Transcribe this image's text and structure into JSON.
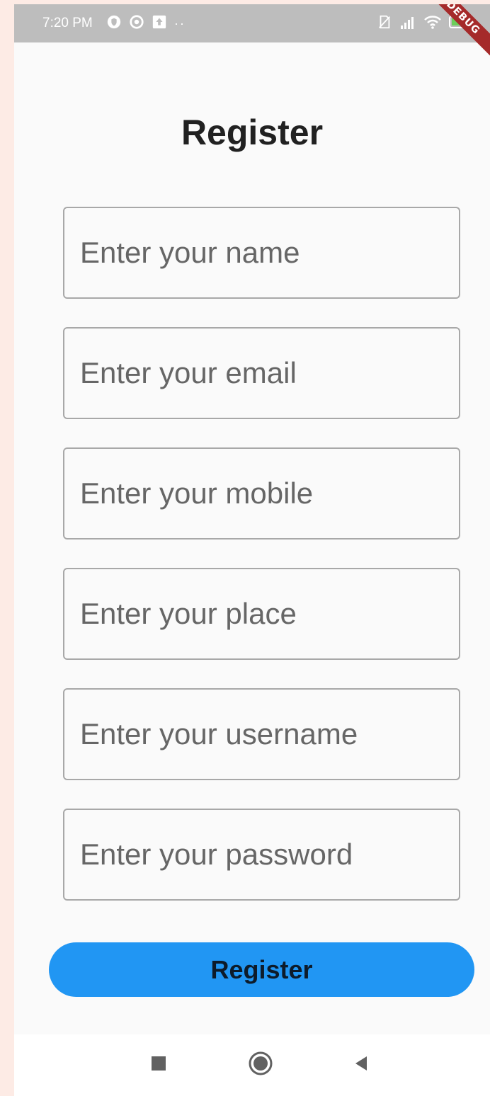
{
  "status_bar": {
    "time": "7:20 PM",
    "dots": "··",
    "debug_label": "DEBUG"
  },
  "page": {
    "title": "Register"
  },
  "form": {
    "name_placeholder": "Enter your name",
    "email_placeholder": "Enter your email",
    "mobile_placeholder": "Enter your mobile",
    "place_placeholder": "Enter your place",
    "username_placeholder": "Enter your username",
    "password_placeholder": "Enter your password",
    "submit_label": "Register"
  },
  "colors": {
    "primary": "#2196f3",
    "status_bar": "#bdbdbd",
    "debug_ribbon": "#a52a2a",
    "background": "#fafafa"
  },
  "icons": {
    "status_left": [
      "shield-icon",
      "circle-at-icon",
      "upload-icon"
    ],
    "status_right": [
      "no-sim-icon",
      "signal-icon",
      "wifi-icon",
      "battery-icon"
    ],
    "navigation": [
      "recents-square-icon",
      "home-circle-icon",
      "back-triangle-icon"
    ]
  }
}
